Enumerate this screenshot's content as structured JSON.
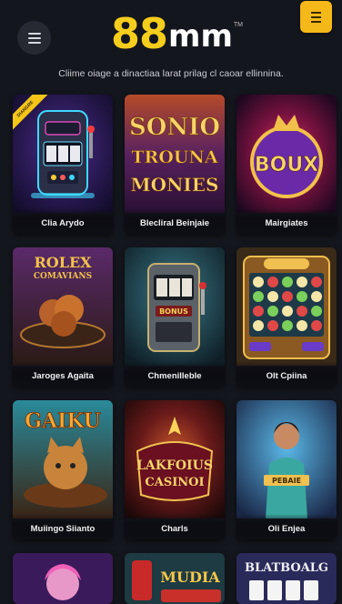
{
  "header": {
    "logo_num": "88",
    "logo_txt": "mm",
    "logo_tm": "TM",
    "menu_icon": "menu-icon",
    "hamburger_icon": "hamburger-icon"
  },
  "tagline": "Cliime oiage a dinactiaa larat prilag cl caoar ellinnina.",
  "games": [
    {
      "label": "Clia Arydo"
    },
    {
      "label": "Blecliral Beinjaie"
    },
    {
      "label": "Mairgiates"
    },
    {
      "label": "Jaroges Agaita"
    },
    {
      "label": "Chmenilleble"
    },
    {
      "label": "Olt Cpiina"
    },
    {
      "label": "Muiingo Siianto"
    },
    {
      "label": "Charls"
    },
    {
      "label": "Oli Enjea"
    },
    {
      "label": ""
    },
    {
      "label": ""
    },
    {
      "label": ""
    }
  ],
  "art_text": {
    "sonic": [
      "SONIO",
      "TROUNA",
      "MONIES"
    ],
    "boux": "BOUX",
    "rolex": [
      "ROLEX",
      "COMAVIANS"
    ],
    "bonus": "BONUS",
    "gaiku": "GAIKU",
    "casino": [
      "LAKFOIUS",
      "CASINOI"
    ],
    "enjea_band": "PEBAIE",
    "mudia": "MUDIA",
    "blatboalg": "BLATBOALG",
    "ribbon": "DIANGRE"
  },
  "colors": {
    "accent": "#f5cd1c",
    "button": "#f4b818",
    "background": "#14161d"
  }
}
